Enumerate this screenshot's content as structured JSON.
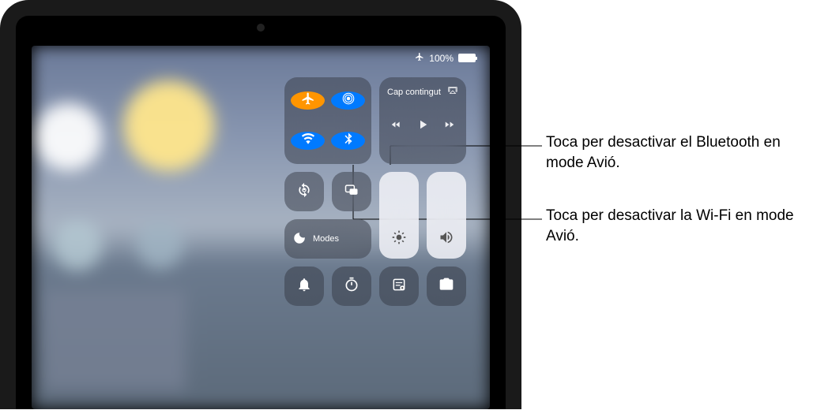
{
  "status": {
    "battery_percent": "100%"
  },
  "media": {
    "title": "Cap contingut"
  },
  "modes": {
    "label": "Modes"
  },
  "callouts": {
    "bluetooth": "Toca per desactivar el Bluetooth en mode Avió.",
    "wifi": "Toca per desactivar la Wi-Fi en mode Avió."
  },
  "icon_names": {
    "airplane": "airplane-icon",
    "airdrop": "airdrop-icon",
    "wifi": "wifi-icon",
    "bluetooth": "bluetooth-icon",
    "rotation_lock": "rotation-lock-icon",
    "screen_mirroring": "screen-mirroring-icon",
    "focus": "moon-icon",
    "brightness": "brightness-icon",
    "volume": "volume-icon",
    "silent": "bell-icon",
    "timer": "timer-icon",
    "notes": "notes-icon",
    "camera": "camera-icon",
    "airplay": "airplay-icon",
    "prev": "rewind-icon",
    "play": "play-icon",
    "next": "forward-icon"
  }
}
